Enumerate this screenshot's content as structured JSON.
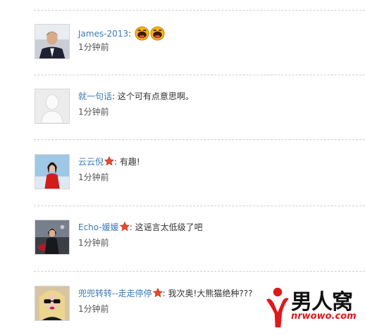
{
  "comments": [
    {
      "user": "James-2013",
      "separator": ":",
      "message": "",
      "has_star": false,
      "emoticons": [
        "laugh-emoticon",
        "laugh-emoticon"
      ],
      "time": "1分钟前"
    },
    {
      "user": "就一句话",
      "separator": ":",
      "message": "这个可有点意思啊。",
      "has_star": false,
      "emoticons": [],
      "time": "1分钟前"
    },
    {
      "user": "云云倪",
      "separator": ":",
      "message": "有趣!",
      "has_star": true,
      "emoticons": [],
      "time": "1分钟前"
    },
    {
      "user": "Echo-媛媛",
      "separator": ":",
      "message": "这谣言太低级了吧",
      "has_star": true,
      "emoticons": [],
      "time": "1分钟前"
    },
    {
      "user": "兜兜转转--走走停停",
      "separator": ":",
      "message": "我次奥!大熊猫绝种???",
      "has_star": true,
      "emoticons": [],
      "time": "1分钟前"
    }
  ],
  "watermark": {
    "brand": "男人窝",
    "url": "nrwowo.com"
  },
  "colors": {
    "username": "#3d7ab3",
    "divider": "#cfcfcf",
    "star": "#e8492a",
    "watermark_red": "#e01919"
  }
}
